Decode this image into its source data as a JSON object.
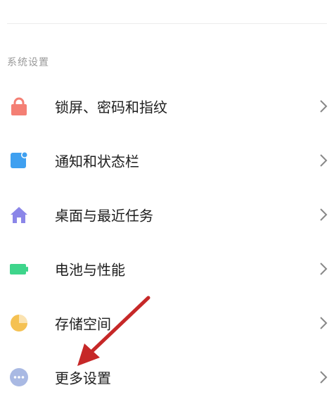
{
  "section": {
    "title": "系统设置"
  },
  "items": [
    {
      "label": "锁屏、密码和指纹",
      "icon": "lock-icon",
      "color": "#F47F74"
    },
    {
      "label": "通知和状态栏",
      "icon": "notification-icon",
      "color": "#3FA0F0"
    },
    {
      "label": "桌面与最近任务",
      "icon": "home-icon",
      "color": "#8B86E8"
    },
    {
      "label": "电池与性能",
      "icon": "battery-icon",
      "color": "#3ED58B"
    },
    {
      "label": "存储空间",
      "icon": "storage-pie-icon",
      "color": "#F5C152"
    },
    {
      "label": "更多设置",
      "icon": "more-icon",
      "color": "#A9B9E3"
    }
  ],
  "annotation": {
    "arrow_color": "#C62828"
  }
}
